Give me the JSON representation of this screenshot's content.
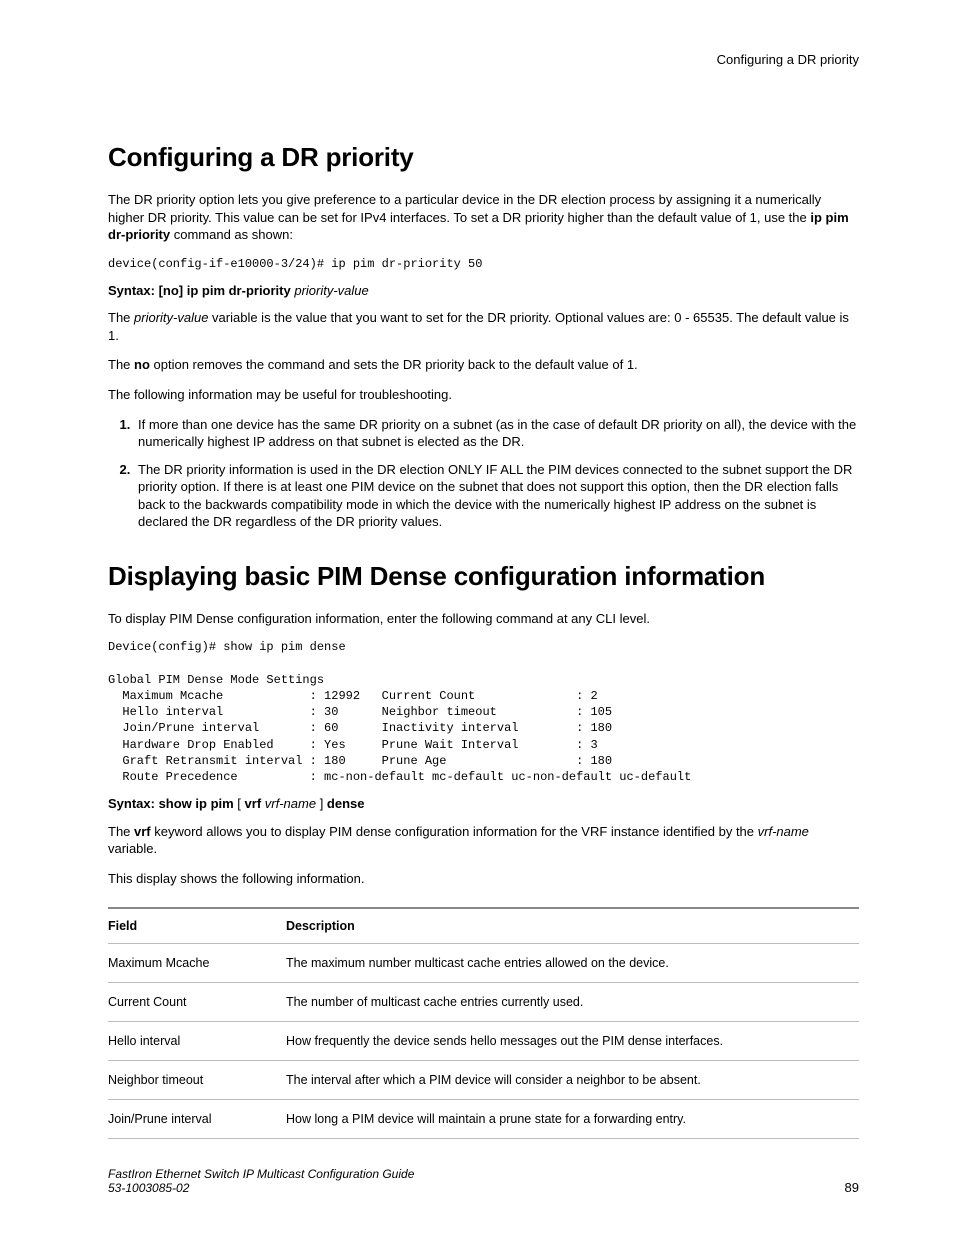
{
  "running_head": "Configuring a DR priority",
  "section1": {
    "heading": "Configuring a DR priority",
    "p1_a": "The DR priority option lets you give preference to a particular device in the DR election process by assigning it a numerically higher DR priority. This value can be set for IPv4 interfaces. To set a DR priority higher than the default value of 1, use the ",
    "p1_b_bold": "ip pim dr-priority",
    "p1_c": " command as shown:",
    "code1": "device(config-if-e10000-3/24)# ip pim dr-priority 50",
    "syntax1_b": "Syntax: [no] ip pim dr-priority ",
    "syntax1_i": "priority-value",
    "p2_a": "The ",
    "p2_i": "priority-value",
    "p2_b": " variable is the value that you want to set for the DR priority. Optional values are: 0 - 65535. The default value is 1.",
    "p3_a": "The ",
    "p3_bold": "no",
    "p3_b": " option removes the command and sets the DR priority back to the default value of 1.",
    "p4": "The following information may be useful for troubleshooting.",
    "li1": "If more than one device has the same DR priority on a subnet (as in the case of default DR priority on all), the device with the numerically highest IP address on that subnet is elected as the DR.",
    "li2": "The DR priority information is used in the DR election ONLY IF ALL the PIM devices connected to the subnet support the DR priority option. If there is at least one PIM device on the subnet that does not support this option, then the DR election falls back to the backwards compatibility mode in which the device with the numerically highest IP address on the subnet is declared the DR regardless of the DR priority values."
  },
  "section2": {
    "heading": "Displaying basic PIM Dense configuration information",
    "p1": "To display PIM Dense configuration information, enter the following command at any CLI level.",
    "code1": "Device(config)# show ip pim dense\n\nGlobal PIM Dense Mode Settings\n  Maximum Mcache            : 12992   Current Count              : 2\n  Hello interval            : 30      Neighbor timeout           : 105\n  Join/Prune interval       : 60      Inactivity interval        : 180\n  Hardware Drop Enabled     : Yes     Prune Wait Interval        : 3\n  Graft Retransmit interval : 180     Prune Age                  : 180\n  Route Precedence          : mc-non-default mc-default uc-non-default uc-default",
    "syntax1_b1": "Syntax: show ip pim",
    "syntax1_mid": " [ ",
    "syntax1_b2": "vrf",
    "syntax1_sp": " ",
    "syntax1_i": "vrf-name",
    "syntax1_mid2": " ] ",
    "syntax1_b3": "dense",
    "p2_a": "The ",
    "p2_bold": "vrf",
    "p2_b": " keyword allows you to display PIM dense configuration information for the VRF instance identified by the ",
    "p2_i": "vrf-name",
    "p2_c": " variable.",
    "p3": "This display shows the following information.",
    "table": {
      "h_field": "Field",
      "h_desc": "Description",
      "rows": [
        {
          "f": "Maximum Mcache",
          "d": "The maximum number multicast cache entries allowed on the device."
        },
        {
          "f": "Current Count",
          "d": "The number of multicast cache entries currently used."
        },
        {
          "f": "Hello interval",
          "d": "How frequently the device sends hello messages out the PIM dense interfaces."
        },
        {
          "f": "Neighbor timeout",
          "d": "The interval after which a PIM device will consider a neighbor to be absent."
        },
        {
          "f": "Join/Prune interval",
          "d": "How long a PIM device will maintain a prune state for a forwarding entry."
        }
      ]
    }
  },
  "footer": {
    "title": "FastIron Ethernet Switch IP Multicast Configuration Guide",
    "docnum": "53-1003085-02",
    "page": "89"
  }
}
